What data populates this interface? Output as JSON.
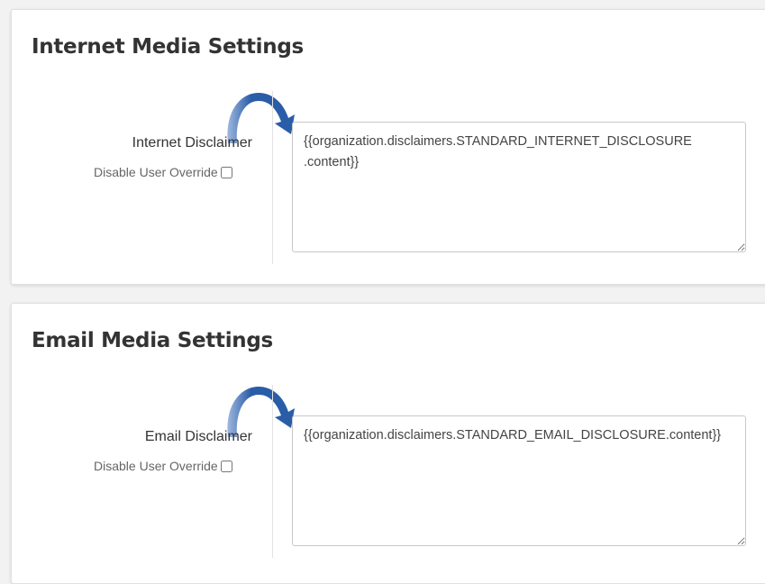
{
  "sections": {
    "internet": {
      "title": "Internet Media Settings",
      "label": "Internet Disclaimer",
      "override_label": "Disable User Override",
      "override_checked": false,
      "value": "{{organization.disclaimers.STANDARD_INTERNET_DISCLOSURE\n.content}}"
    },
    "email": {
      "title": "Email Media Settings",
      "label": "Email Disclaimer",
      "override_label": "Disable User Override",
      "override_checked": false,
      "value": "{{organization.disclaimers.STANDARD_EMAIL_DISCLOSURE.content}}"
    }
  },
  "colors": {
    "arrow": "#2a5da8",
    "page_background": "#f2f2f2",
    "panel_background": "#ffffff"
  },
  "icons": {
    "annotation_arrow": "curved-arrow-icon"
  }
}
